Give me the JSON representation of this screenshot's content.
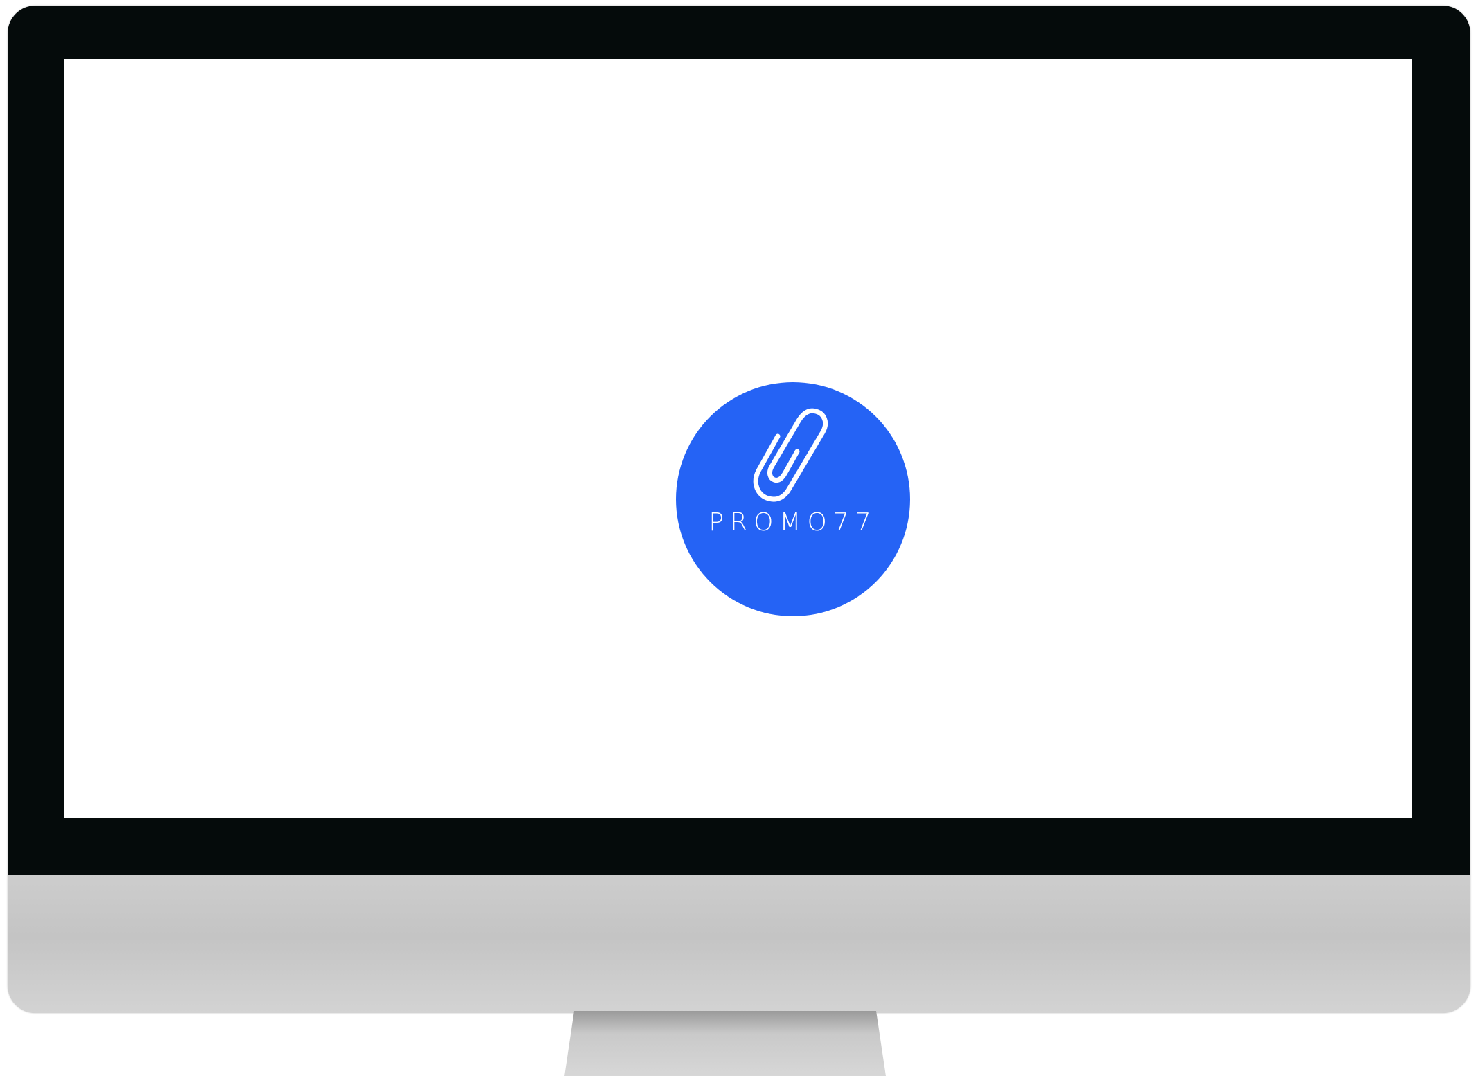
{
  "logo": {
    "text": "PROMO77",
    "icon": "paperclip-icon",
    "circle_color": "#2563f5",
    "foreground_color": "#ffffff"
  },
  "colors": {
    "bezel": "#050b0b",
    "screen": "#ffffff",
    "chin": "#c8c8c8"
  }
}
